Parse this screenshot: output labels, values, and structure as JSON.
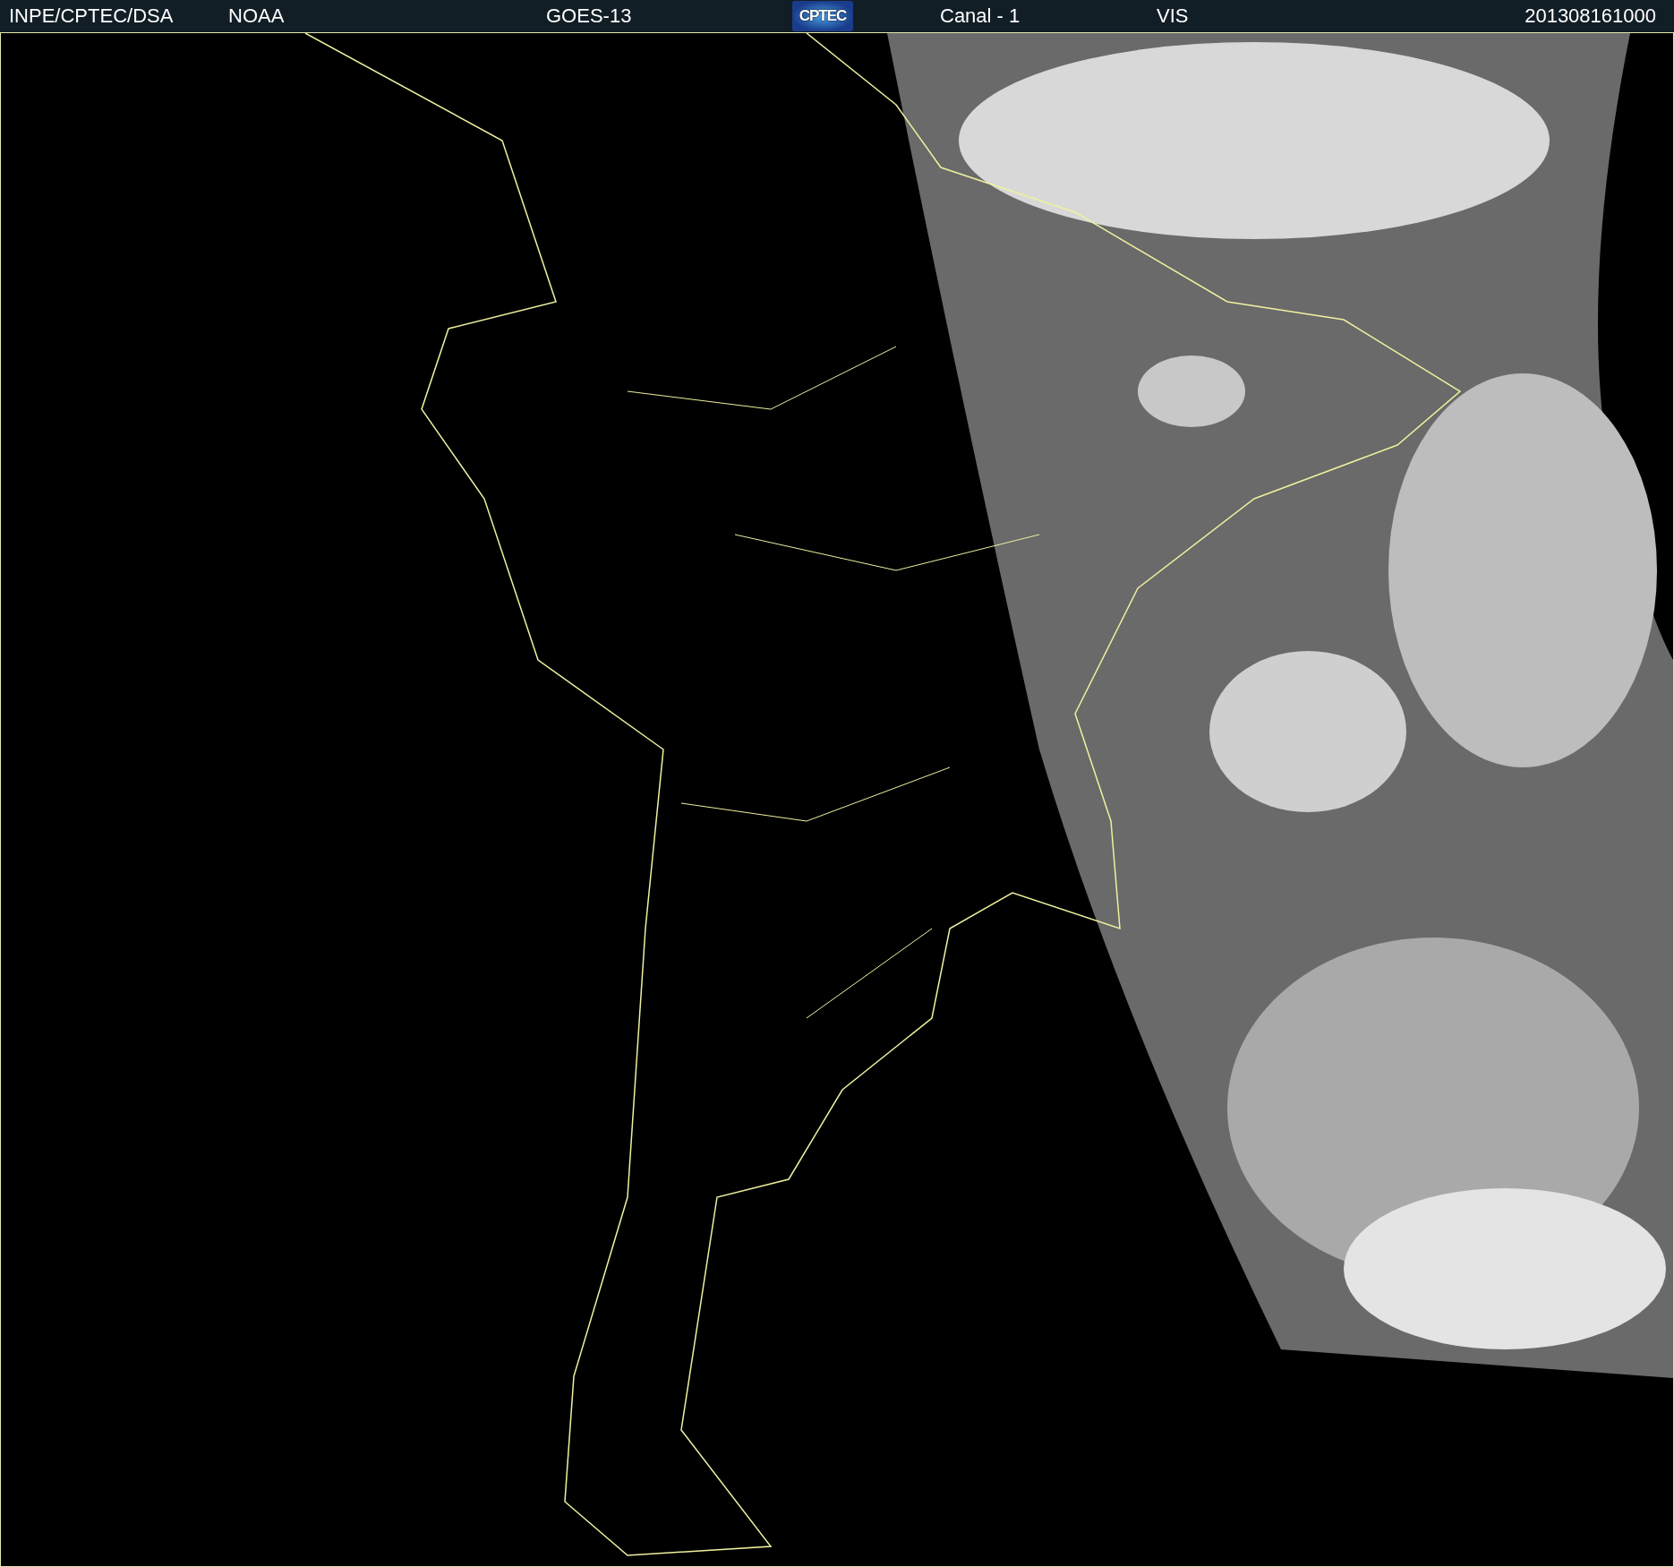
{
  "header": {
    "fields": [
      {
        "kind": "text",
        "text": "INPE/CPTEC/DSA"
      },
      {
        "kind": "text",
        "text": "NOAA"
      },
      {
        "kind": "text",
        "text": "GOES-13"
      },
      {
        "kind": "logo",
        "text": "CPTEC"
      },
      {
        "kind": "text",
        "text": "Canal - 1"
      },
      {
        "kind": "text",
        "text": "VIS"
      },
      {
        "kind": "text",
        "text": "201308161000"
      }
    ]
  }
}
